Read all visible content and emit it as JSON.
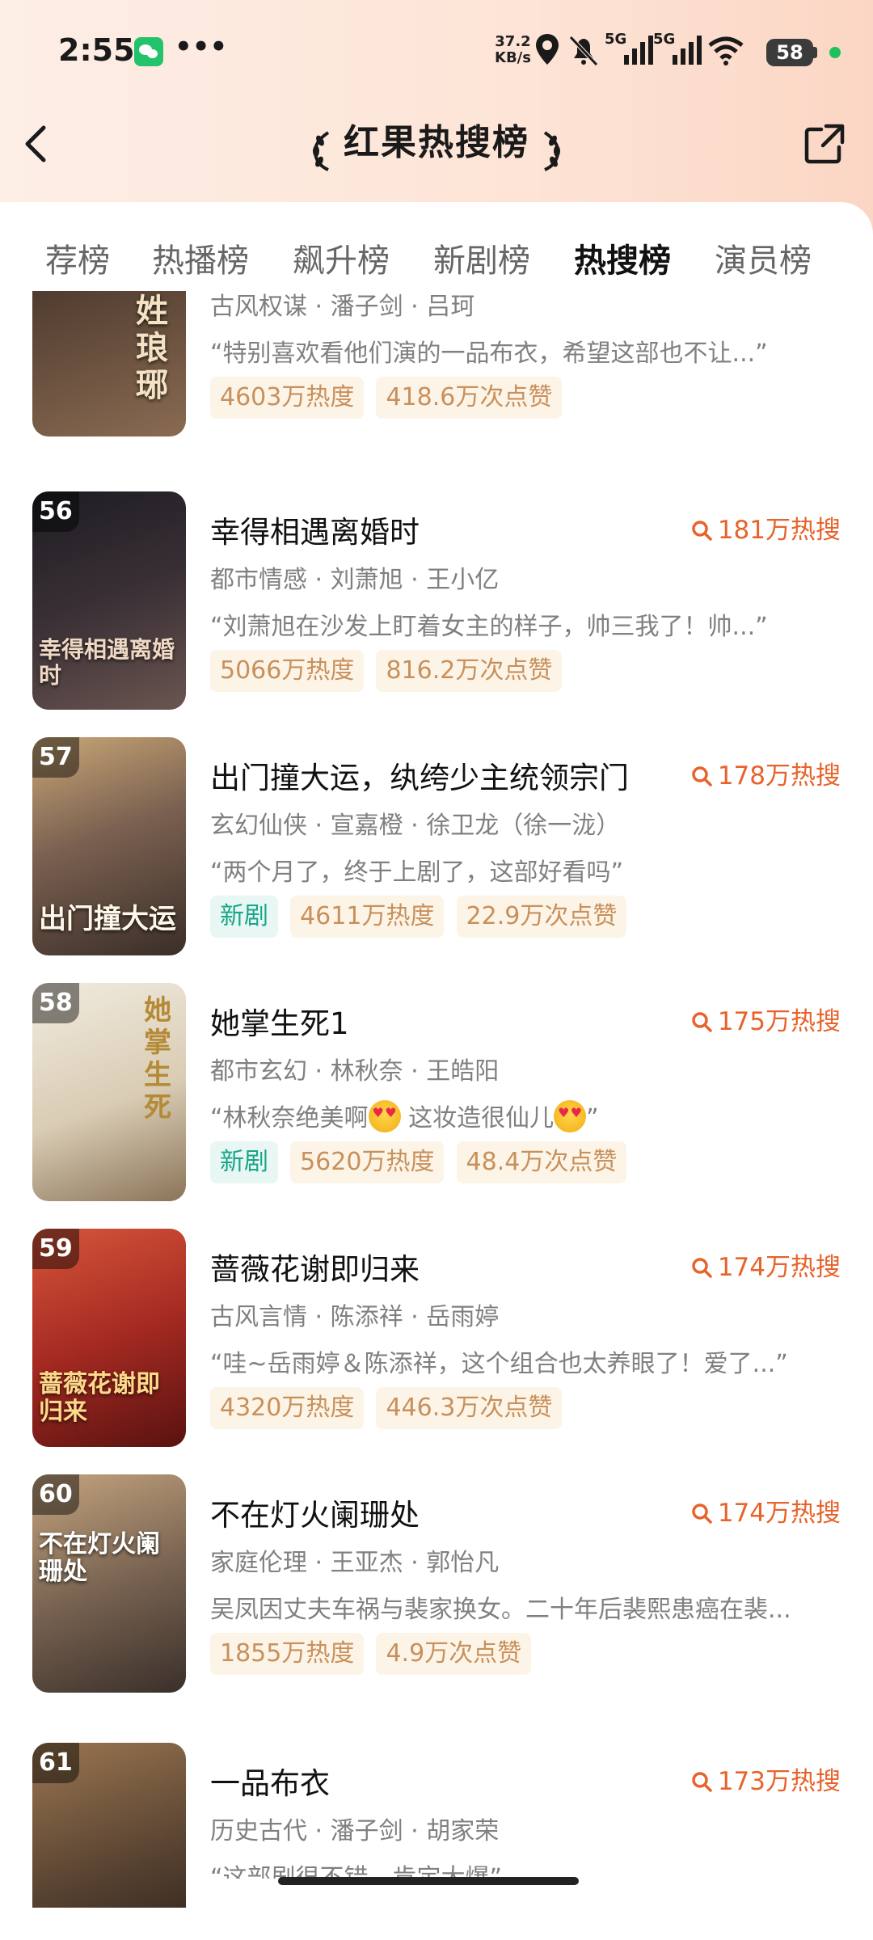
{
  "status_bar": {
    "time": "2:55",
    "dots": "•••",
    "net_speed_value": "37.2",
    "net_speed_unit": "KB/s",
    "signal_1": "5G",
    "signal_2": "5G",
    "battery": "58"
  },
  "nav": {
    "title": "红果热搜榜"
  },
  "tabs": [
    {
      "label": "荐榜",
      "active": false
    },
    {
      "label": "热播榜",
      "active": false
    },
    {
      "label": "飙升榜",
      "active": false
    },
    {
      "label": "新剧榜",
      "active": false
    },
    {
      "label": "热搜榜",
      "active": true
    },
    {
      "label": "演员榜",
      "active": false
    }
  ],
  "items": [
    {
      "rank": "",
      "poster_text": "姓琅琊",
      "title": "",
      "hot": "",
      "meta": "古风权谋 · 潘子剑 · 吕珂",
      "quote": "“特别喜欢看他们演的一品布衣，希望这部也不让...”",
      "new": "",
      "heat": "4603万热度",
      "likes": "418.6万次点赞",
      "colors": [
        "#3a2a22",
        "#8a6b52"
      ]
    },
    {
      "rank": "56",
      "poster_text": "幸得相遇离婚时",
      "title": "幸得相遇离婚时",
      "hot": "181万热搜",
      "meta": "都市情感 · 刘萧旭 · 王小亿",
      "quote": "“刘萧旭在沙发上盯着女主的样子，帅三我了！帅...”",
      "new": "",
      "heat": "5066万热度",
      "likes": "816.2万次点赞",
      "colors": [
        "#1d1d22",
        "#6a5550"
      ]
    },
    {
      "rank": "57",
      "poster_text": "出门撞大运",
      "title": "出门撞大运，纨绔少主统领宗门",
      "hot": "178万热搜",
      "meta": "玄幻仙侠 · 宣嘉橙 · 徐卫龙（徐一泷）",
      "quote": "“两个月了，终于上剧了，这部好看吗”",
      "new": "新剧",
      "heat": "4611万热度",
      "likes": "22.9万次点赞",
      "colors": [
        "#5b4a3c",
        "#c9a776"
      ]
    },
    {
      "rank": "58",
      "poster_text": "她掌生死",
      "title": "她掌生死1",
      "hot": "175万热搜",
      "meta": "都市玄幻 · 林秋奈 · 王皓阳",
      "quote_a": "“林秋奈绝美啊",
      "quote_b": " 这妆造很仙儿",
      "quote_c": "”",
      "new": "新剧",
      "heat": "5620万热度",
      "likes": "48.4万次点赞",
      "colors": [
        "#e9e1d2",
        "#b09a78"
      ]
    },
    {
      "rank": "59",
      "poster_text": "蔷薇花谢即归来",
      "title": "蔷薇花谢即归来",
      "hot": "174万热搜",
      "meta": "古风言情 · 陈添祥 · 岳雨婷",
      "quote": "“哇~岳雨婷＆陈添祥，这个组合也太养眼了！爱了...”",
      "new": "",
      "heat": "4320万热度",
      "likes": "446.3万次点赞",
      "colors": [
        "#8c1d1a",
        "#d6563a"
      ]
    },
    {
      "rank": "60",
      "poster_text": "不在灯火阑珊处",
      "title": "不在灯火阑珊处",
      "hot": "174万热搜",
      "meta": "家庭伦理 · 王亚杰 · 郭怡凡",
      "quote": "吴凤因丈夫车祸与裴家换女。二十年后裴熙患癌在裴...",
      "new": "",
      "heat": "1855万热度",
      "likes": "4.9万次点赞",
      "colors": [
        "#4a4038",
        "#c4a47e"
      ]
    },
    {
      "rank": "61",
      "poster_text": "",
      "title": "一品布衣",
      "hot": "173万热搜",
      "meta": "历史古代 · 潘子剑 · 胡家荣",
      "quote": "“这部剧很不错，肯定大爆”",
      "new": "",
      "heat": "",
      "likes": "",
      "colors": [
        "#3c2e26",
        "#9a7650"
      ]
    }
  ]
}
